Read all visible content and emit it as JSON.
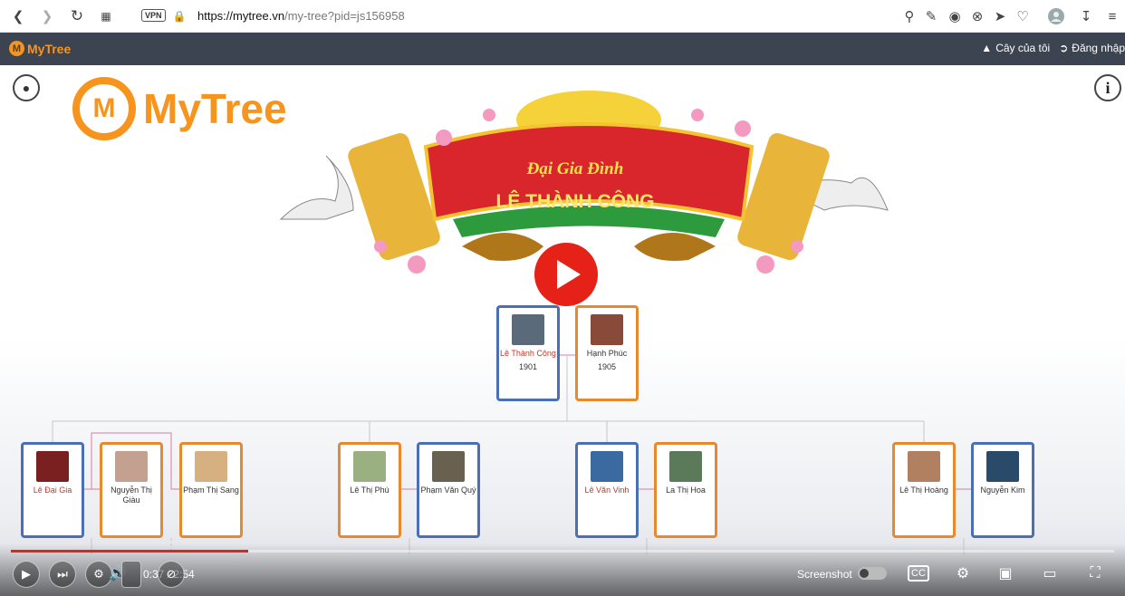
{
  "browser": {
    "url_domain": "https://mytree.vn",
    "url_path": "/my-tree?pid=js156958",
    "vpn_label": "VPN"
  },
  "site": {
    "logo_text": "MyTree",
    "nav_my_tree": "Cây của tôi",
    "nav_login": "Đăng nhập"
  },
  "hero": {
    "logo_text": "MyTree",
    "banner_line1": "Đại Gia Đình",
    "banner_line2": "LÊ THÀNH CÔNG"
  },
  "tree": {
    "root": [
      {
        "name": "Lê Thành Công",
        "year": "1901",
        "gender": "m",
        "photo": "#5a6a7a"
      },
      {
        "name": "Hạnh Phúc",
        "year": "1905",
        "gender": "f",
        "photo": "#8a4a3a"
      }
    ],
    "children": [
      {
        "name": "Lê Đại Gia",
        "gender": "m",
        "photo": "#7a2020"
      },
      {
        "name": "Nguyễn Thị Giàu",
        "gender": "f",
        "photo": "#c4a090"
      },
      {
        "name": "Phạm Thị Sang",
        "gender": "f",
        "photo": "#d6b080"
      },
      {
        "name": "Lê Thị Phú",
        "gender": "f",
        "photo": "#9ab080"
      },
      {
        "name": "Phạm Văn Quý",
        "gender": "m",
        "photo": "#6a6050"
      },
      {
        "name": "Lê Văn Vinh",
        "gender": "m",
        "photo": "#3a6aa0"
      },
      {
        "name": "La Thị Hoa",
        "gender": "f",
        "photo": "#5a7a5a"
      },
      {
        "name": "Lê Thị Hoàng",
        "gender": "f",
        "photo": "#b08060"
      },
      {
        "name": "Nguyễn Kim",
        "gender": "m",
        "photo": "#2a4a6a"
      }
    ]
  },
  "video": {
    "time": "0:37 / 2:54",
    "progress": 0.215,
    "screenshot_label": "Screenshot",
    "play_color": "#e62117"
  }
}
